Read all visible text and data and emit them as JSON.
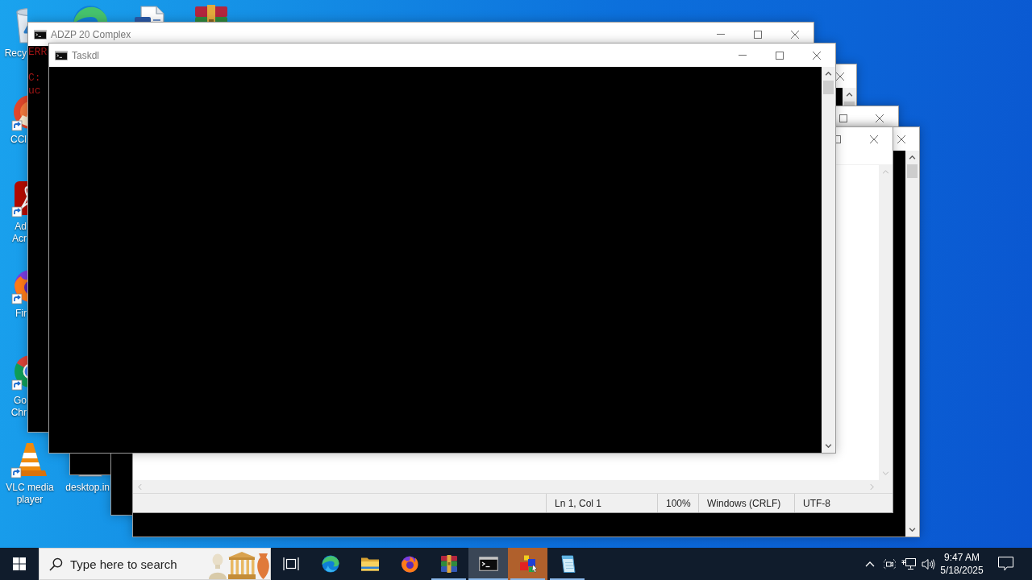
{
  "desktop": {
    "icons": [
      {
        "kind": "recycle-bin",
        "shortcut": false,
        "label_lines": [
          "Recy"
        ]
      },
      {
        "kind": "swirl-browser"
      },
      {
        "kind": "document"
      },
      {
        "kind": "archive"
      },
      {
        "kind": "cleaner",
        "shortcut": true,
        "label_lines": [
          "CCl"
        ]
      },
      {
        "kind": "pdf",
        "shortcut": true,
        "label_lines": [
          "Ad",
          "Acr"
        ]
      },
      {
        "kind": "fox-browser",
        "shortcut": true,
        "label_lines": [
          "Fir"
        ]
      },
      {
        "kind": "ring-browser",
        "shortcut": true,
        "label_lines": [
          "Go",
          "Chr"
        ]
      },
      {
        "kind": "media-player",
        "shortcut": true,
        "label_lines": [
          "VLC media",
          "player"
        ]
      },
      {
        "kind": "settings-file",
        "shortcut": false,
        "label_lines": [
          "desktop.in"
        ]
      }
    ]
  },
  "windows": [
    {
      "kind": "console",
      "title": "ADZP 20 Complex",
      "lines": [
        "ERR",
        "C:",
        "uc"
      ]
    },
    {
      "kind": "console",
      "title": "Taskdl"
    },
    {
      "kind": "console"
    },
    {
      "kind": "console"
    },
    {
      "kind": "notepad",
      "status": [
        "Ln 1, Col 1",
        "100%",
        "Windows (CRLF)",
        "UTF-8"
      ]
    },
    {
      "kind": "console"
    }
  ],
  "taskbar": {
    "search": {
      "placeholder": "Type here to search"
    },
    "apps": [
      {
        "kind": "swirl-browser",
        "running": false,
        "active": false,
        "flashing": false
      },
      {
        "kind": "folder",
        "running": false,
        "active": false,
        "flashing": false
      },
      {
        "kind": "fox-browser",
        "running": false,
        "active": false,
        "flashing": false
      },
      {
        "kind": "archive",
        "running": true,
        "active": false,
        "flashing": false
      },
      {
        "kind": "terminal",
        "running": true,
        "active": true,
        "flashing": false
      },
      {
        "kind": "blocks",
        "running": true,
        "active": false,
        "flashing": true
      },
      {
        "kind": "notepad",
        "running": true,
        "active": false,
        "flashing": false
      }
    ],
    "clock": {
      "time": "9:47 AM",
      "date": "5/18/2025"
    }
  }
}
